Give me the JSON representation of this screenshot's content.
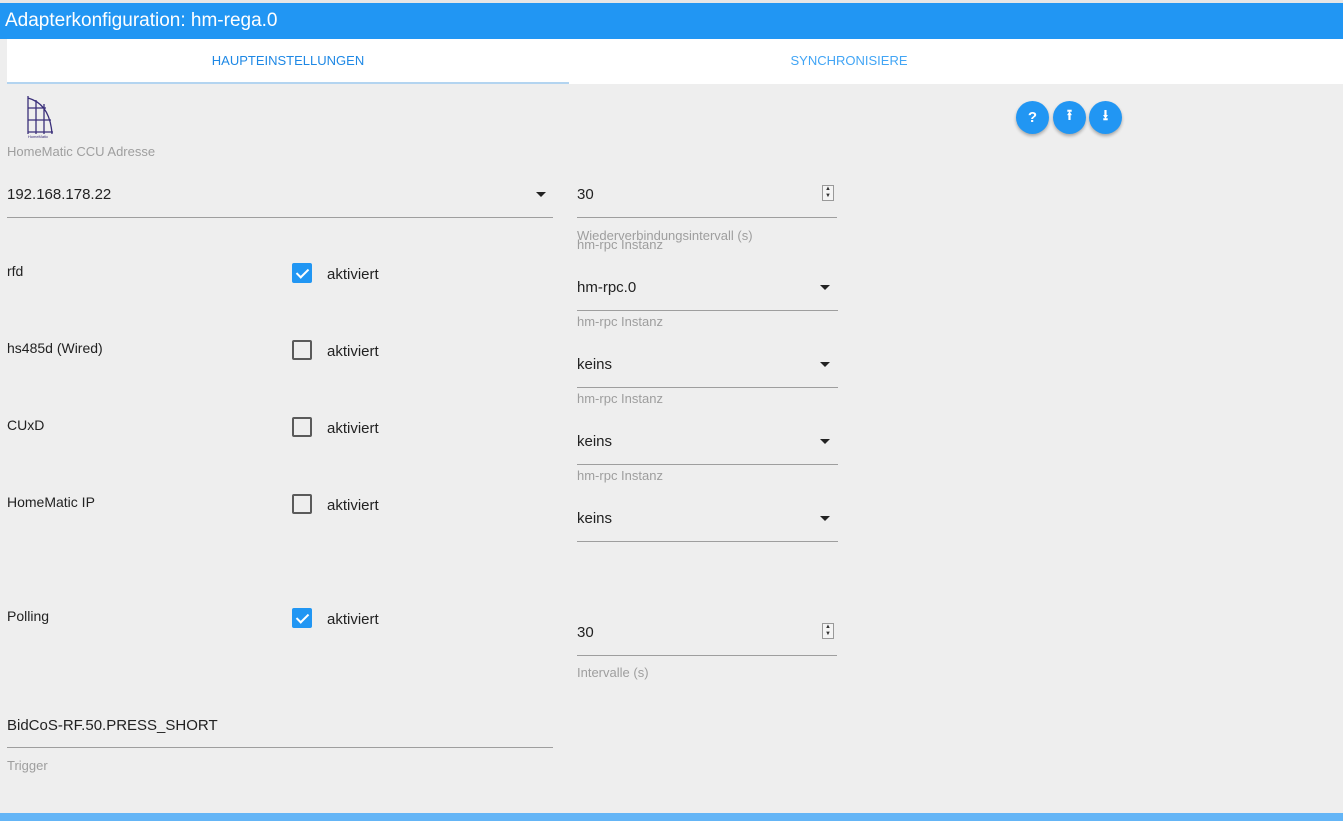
{
  "title": "Adapterkonfiguration: hm-rega.0",
  "tabs": [
    {
      "label": "HAUPTEINSTELLUNGEN"
    },
    {
      "label": "SYNCHRONISIERE"
    }
  ],
  "logo_text": "HomeMatic",
  "ccu": {
    "label": "HomeMatic CCU Adresse",
    "value": "192.168.178.22"
  },
  "reconnect": {
    "value": "30",
    "label": "Wiederverbindungsintervall (s)"
  },
  "rows": [
    {
      "label": "rfd",
      "checkbox": "aktiviert",
      "checked": true,
      "instance_label": "hm-rpc Instanz",
      "instance": "hm-rpc.0"
    },
    {
      "label": "hs485d (Wired)",
      "checkbox": "aktiviert",
      "checked": false,
      "instance_label": "hm-rpc Instanz",
      "instance": "keins"
    },
    {
      "label": "CUxD",
      "checkbox": "aktiviert",
      "checked": false,
      "instance_label": "hm-rpc Instanz",
      "instance": "keins"
    },
    {
      "label": "HomeMatic IP",
      "checkbox": "aktiviert",
      "checked": false,
      "instance_label": "hm-rpc Instanz",
      "instance": "keins"
    }
  ],
  "polling": {
    "label": "Polling",
    "checkbox": "aktiviert",
    "checked": true,
    "interval": "30",
    "interval_label": "Intervalle (s)"
  },
  "trigger": {
    "value": "BidCoS-RF.50.PRESS_SHORT",
    "label": "Trigger"
  },
  "buttons": {
    "help": "?",
    "upload": "⭱",
    "download": "⭳"
  },
  "colors": {
    "accent": "#2196f3"
  }
}
